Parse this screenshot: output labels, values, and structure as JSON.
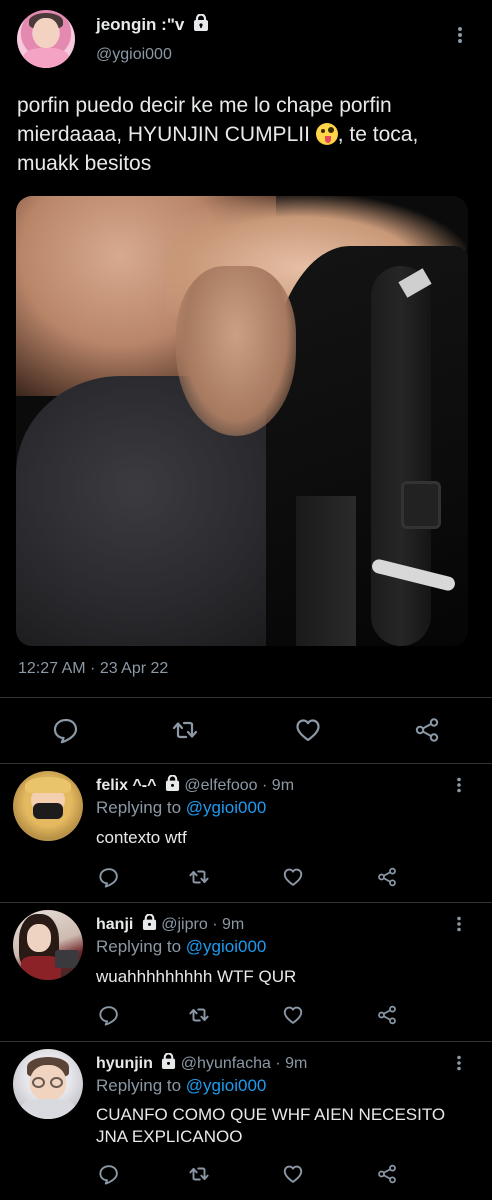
{
  "main_tweet": {
    "display_name": "jeongin :\"v",
    "handle": "@ygioi000",
    "text_parts": [
      "porfin puedo decir ke me lo chape porfin mierdaaaa, HYUNJIN CUMPLII ",
      ", te toca, muakk besitos"
    ],
    "emoji": "zany-face-emoji",
    "timestamp": "12:27 AM · 23 Apr 22"
  },
  "icons": {
    "reply": "reply-icon",
    "retweet": "retweet-icon",
    "like": "heart-icon",
    "share": "share-icon",
    "lock": "lock-icon",
    "more": "more-icon"
  },
  "colors": {
    "background": "#000000",
    "text": "#e7e9ea",
    "muted": "#8b98a5",
    "mention": "#1d9bf0",
    "divider": "#2f3336"
  },
  "replies": [
    {
      "name": "felix ^-^",
      "handle": "@elfefooo",
      "time": "· 9m",
      "replying_label": "Replying to",
      "replying_to": "@ygioi000",
      "text": "contexto wtf"
    },
    {
      "name": "hanji",
      "handle": "@jipro",
      "time": "· 9m",
      "replying_label": "Replying to",
      "replying_to": "@ygioi000",
      "text": "wuahhhhhhhhh WTF QUR"
    },
    {
      "name": "hyunjin",
      "handle": "@hyunfacha",
      "time": "· 9m",
      "replying_label": "Replying to",
      "replying_to": "@ygioi000",
      "text": "CUANFO COMO QUE WHF AIEN NECESITO JNA EXPLICANOO"
    }
  ]
}
